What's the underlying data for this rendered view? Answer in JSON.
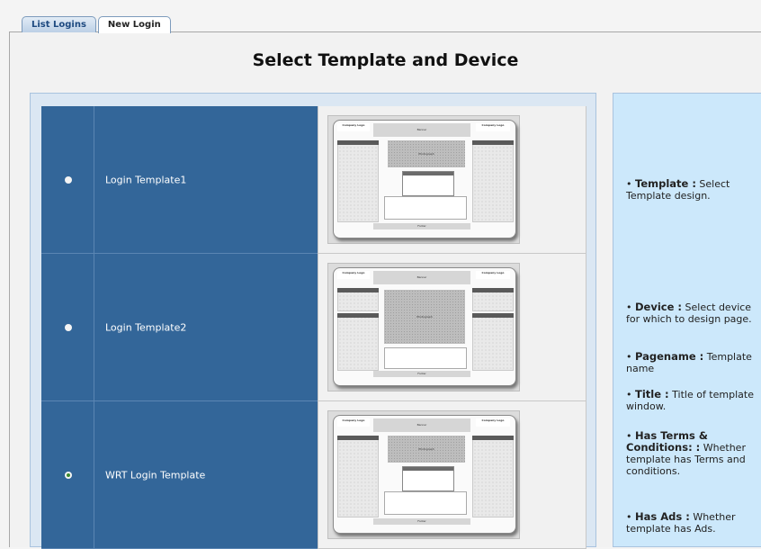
{
  "tabs": {
    "list_logins": "List Logins",
    "new_login": "New Login"
  },
  "page_title": "Select Template and Device",
  "templates": [
    {
      "name": "Login Template1",
      "selected": false
    },
    {
      "name": "Login Template2",
      "selected": false
    },
    {
      "name": "WRT Login Template",
      "selected": true
    }
  ],
  "thumb_labels": {
    "company_logo": "Company Logo",
    "banner": "Banner",
    "photograph": "Photograph",
    "footer": "Footer",
    "login": "Login",
    "username": "Username",
    "password": "Password",
    "advertisement": "Advertisement",
    "our_links": "Our Links",
    "sign_up": "Sign Up"
  },
  "help": [
    {
      "term": "Template :",
      "desc": " Select Template design."
    },
    {
      "term": "Device :",
      "desc": " Select device for which to design page."
    },
    {
      "term": "Pagename :",
      "desc": " Template name"
    },
    {
      "term": "Title :",
      "desc": " Title of template window."
    },
    {
      "term": "Has Terms & Conditions: :",
      "desc": " Whether template has Terms and conditions."
    },
    {
      "term": "Has Ads :",
      "desc": " Whether template has Ads."
    }
  ]
}
